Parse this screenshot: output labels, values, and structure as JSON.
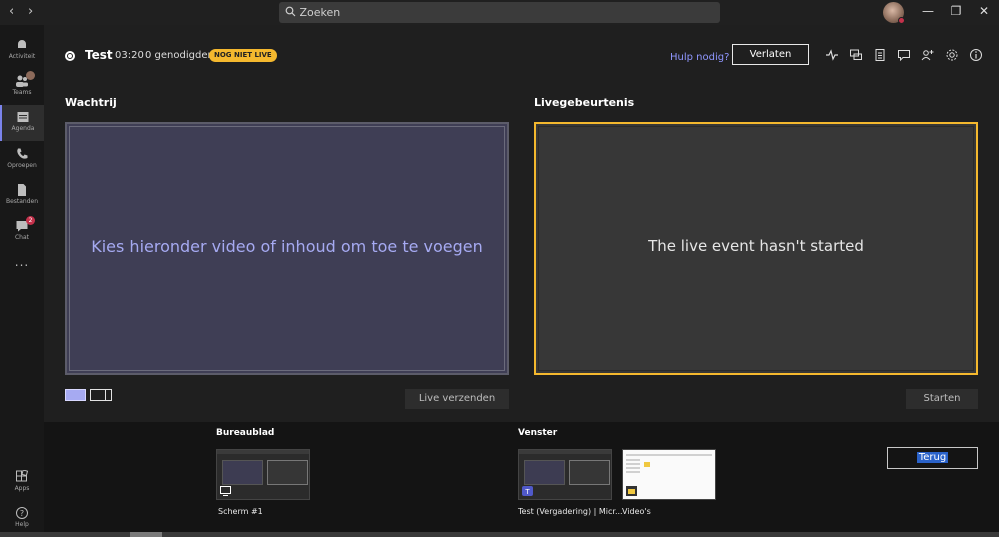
{
  "search": {
    "placeholder": "Zoeken"
  },
  "rail": {
    "items": [
      {
        "label": "Activiteit",
        "icon": "bell-icon"
      },
      {
        "label": "Teams",
        "icon": "teams-icon",
        "badge": ""
      },
      {
        "label": "Agenda",
        "icon": "calendar-icon"
      },
      {
        "label": "Oproepen",
        "icon": "phone-icon"
      },
      {
        "label": "Bestanden",
        "icon": "file-icon"
      },
      {
        "label": "Chat",
        "icon": "chat-icon",
        "badge": "2"
      },
      {
        "label": "...",
        "icon": "more-icon"
      }
    ],
    "bottom": [
      {
        "label": "Apps",
        "icon": "apps-icon"
      },
      {
        "label": "Help",
        "icon": "help-icon"
      }
    ]
  },
  "header": {
    "title": "Test",
    "time": "03:20",
    "attendees": "0 genodigden",
    "status": "NOG NIET LIVE",
    "help": "Hulp nodig?",
    "leave": "Verlaten"
  },
  "queue": {
    "label": "Wachtrij",
    "message": "Kies hieronder video of inhoud om toe te voegen",
    "send": "Live verzenden"
  },
  "live": {
    "label": "Livegebeurtenis",
    "message": "The live event hasn't started",
    "start": "Starten"
  },
  "sources": {
    "desktop_label": "Bureaublad",
    "window_label": "Venster",
    "desktop_items": [
      "Scherm #1"
    ],
    "window_items": [
      "Test (Vergadering) | Micr...",
      "Video's"
    ],
    "back": "Terug"
  },
  "colors": {
    "accent": "#7b83eb",
    "live_border": "#f4b82e",
    "queue_bg": "#3f3e55"
  }
}
